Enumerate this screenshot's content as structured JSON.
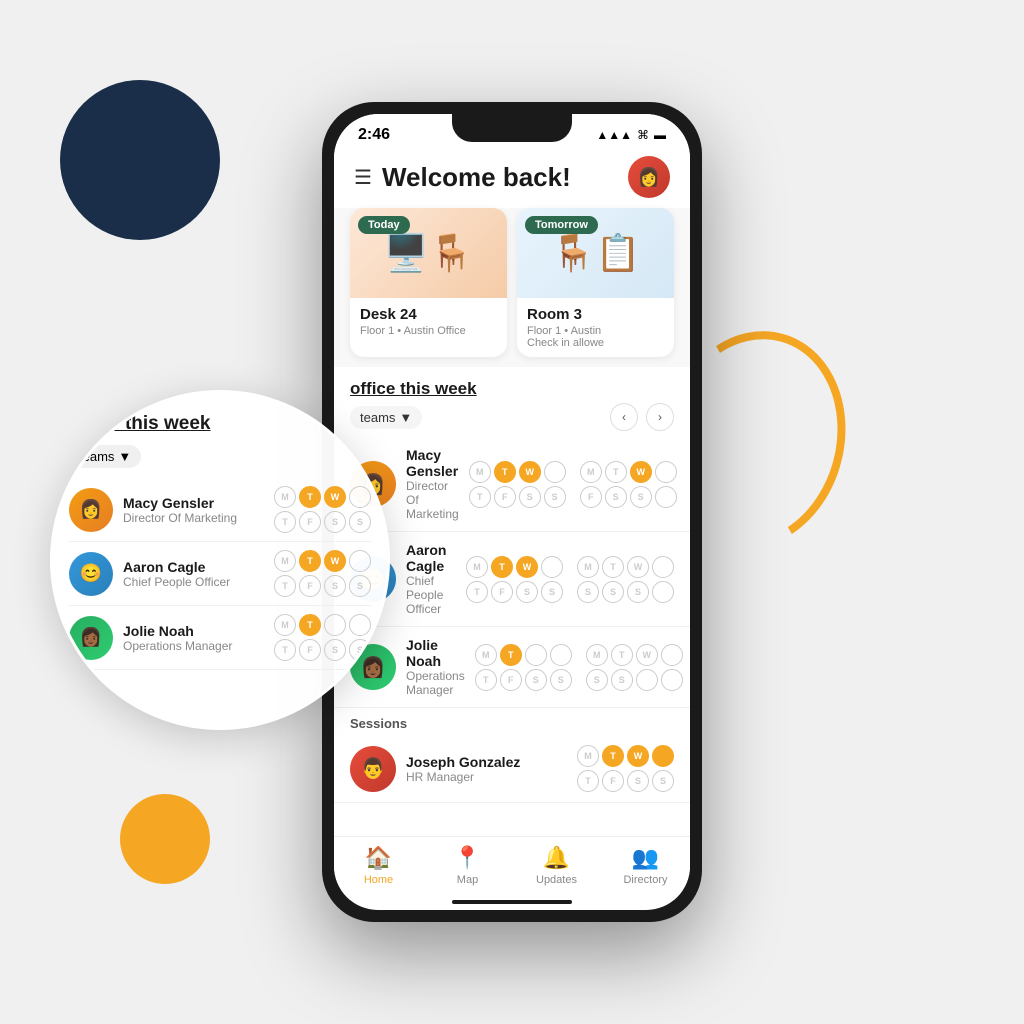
{
  "decorative": {
    "dark_circle": "dark-blue decorative circle",
    "orange_circle": "orange decorative circle",
    "orange_arc": "orange arc decorative"
  },
  "status_bar": {
    "time": "2:46",
    "signal": "▲▲▲",
    "wifi": "WiFi",
    "battery": "Battery"
  },
  "header": {
    "title": "Welcome back!",
    "menu_icon": "☰",
    "avatar_emoji": "👩"
  },
  "booking_cards": [
    {
      "badge": "Today",
      "title": "Desk 24",
      "subtitle": "Floor 1 • Austin Office",
      "type": "today"
    },
    {
      "badge": "Tomorrow",
      "title": "Room 3",
      "subtitle": "Floor 1 • Austin\nCheck in allowe",
      "type": "tomorrow"
    }
  ],
  "office_section": {
    "title_prefix": "office ",
    "title_underline": "this week",
    "teams_label": "teams",
    "teams_dropdown_arrow": "▼"
  },
  "people": [
    {
      "name": "Macy Gensler",
      "role": "Director Of Marketing",
      "avatar_class": "macy",
      "emoji": "👩",
      "days_row1": [
        "M",
        "T",
        "W",
        ""
      ],
      "days_row1_filled": [
        false,
        true,
        true,
        false
      ],
      "days_row2": [
        "T",
        "F",
        "S",
        "S"
      ],
      "days_row2_filled": [
        false,
        false,
        false,
        false
      ],
      "days_row2_grey": [
        false,
        false,
        true,
        true
      ]
    },
    {
      "name": "Aaron Cagle",
      "role": "Chief People Officer",
      "avatar_class": "aaron",
      "emoji": "👨",
      "days_row1": [
        "M",
        "T",
        "W",
        ""
      ],
      "days_row1_filled": [
        false,
        true,
        true,
        false
      ],
      "days_row2": [
        "T",
        "F",
        "S",
        "S"
      ],
      "days_row2_filled": [
        false,
        false,
        false,
        false
      ],
      "days_row2_grey": [
        false,
        false,
        true,
        true
      ]
    },
    {
      "name": "Jolie Noah",
      "role": "Operations Manager",
      "avatar_class": "jolie",
      "emoji": "👩🏾",
      "days_row1": [
        "M",
        "T",
        "",
        ""
      ],
      "days_row1_filled": [
        false,
        true,
        false,
        false
      ],
      "days_row2": [
        "T",
        "F",
        "S",
        "S"
      ],
      "days_row2_filled": [
        false,
        false,
        false,
        false
      ],
      "days_row2_grey": [
        false,
        false,
        true,
        true
      ]
    },
    {
      "name": "Joseph Gonzalez",
      "role": "HR Manager",
      "avatar_class": "joseph",
      "emoji": "👨",
      "days_row1": [
        "M",
        "T",
        "W",
        ""
      ],
      "days_row1_filled": [
        false,
        true,
        true,
        true
      ],
      "days_row2": [
        "T",
        "F",
        "S",
        "S"
      ],
      "days_row2_filled": [
        false,
        false,
        false,
        false
      ],
      "days_row2_grey": [
        false,
        false,
        true,
        true
      ]
    }
  ],
  "sessions_label": "Sessions",
  "bottom_nav": [
    {
      "label": "Home",
      "icon": "🏠",
      "active": true
    },
    {
      "label": "Map",
      "icon": "📍",
      "active": false
    },
    {
      "label": "Updates",
      "icon": "🔔",
      "active": false
    },
    {
      "label": "Directory",
      "icon": "👥",
      "active": false
    }
  ],
  "magnify": {
    "title_prefix": "office ",
    "title_underline": "this week",
    "dropdown_label": "teams",
    "people": [
      {
        "name": "Macy Gensler",
        "role": "Director Of Marketing",
        "class": "mag-macy",
        "days": [
          "M",
          "T",
          "W",
          "T",
          "F",
          "S",
          "S",
          ""
        ],
        "filled": [
          false,
          true,
          true,
          false,
          false,
          false,
          false,
          false
        ]
      },
      {
        "name": "Aaron Cagle",
        "role": "Chief People Officer",
        "class": "mag-aaron",
        "days": [
          "M",
          "T",
          "W",
          "T",
          "F",
          "S",
          "S",
          ""
        ],
        "filled": [
          false,
          true,
          true,
          false,
          false,
          false,
          false,
          false
        ]
      },
      {
        "name": "Jolie Noah",
        "role": "Operations Manager",
        "class": "mag-jolie",
        "days": [
          "M",
          "T",
          "",
          "T",
          "F",
          "S",
          "S",
          ""
        ],
        "filled": [
          false,
          true,
          false,
          false,
          false,
          false,
          false,
          false
        ]
      }
    ]
  }
}
